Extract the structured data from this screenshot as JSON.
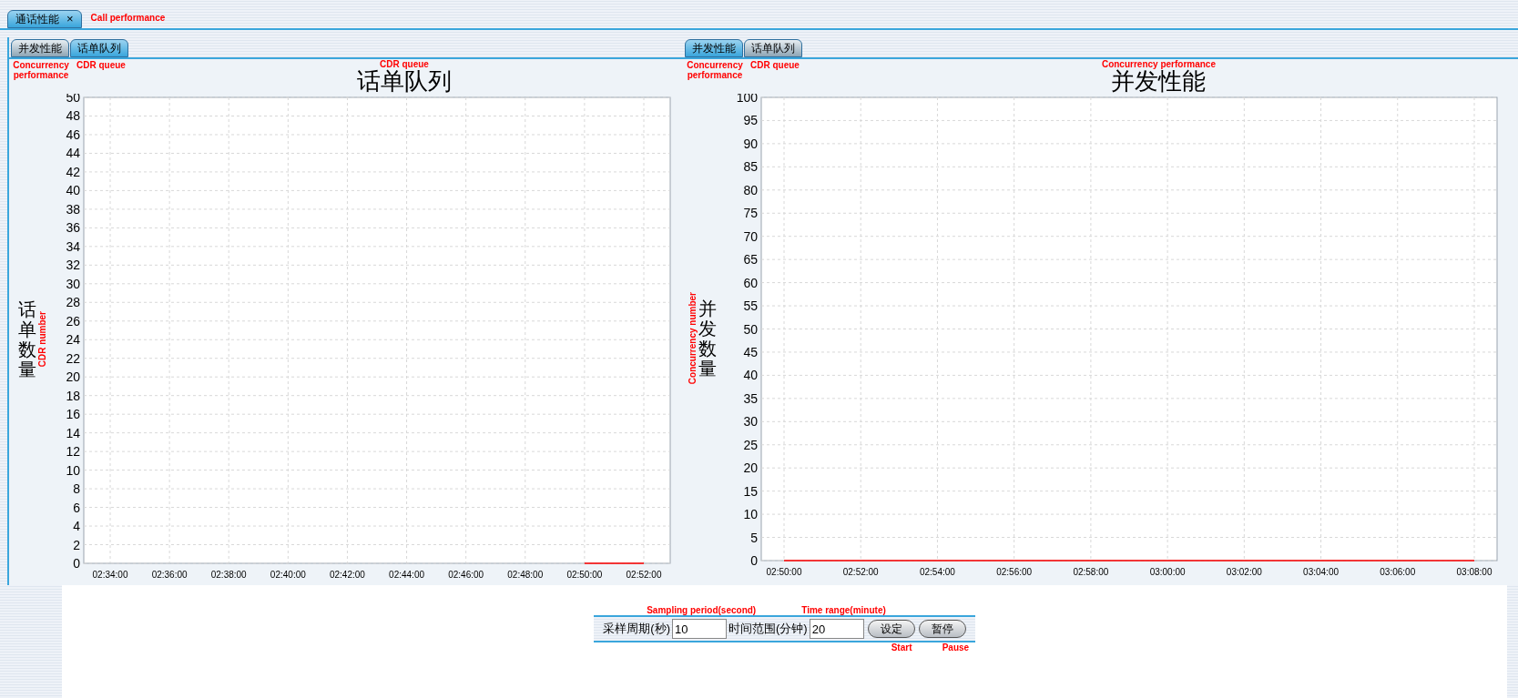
{
  "main_tab": {
    "label": "通话性能",
    "close": "×",
    "selected": true,
    "note": "Call performance"
  },
  "panels": [
    {
      "tabs": [
        {
          "label": "并发性能",
          "note": "Concurrency performance",
          "selected": false
        },
        {
          "label": "话单队列",
          "note": "CDR queue",
          "selected": true
        }
      ],
      "title": "话单队列",
      "title_note": "CDR queue",
      "ylabel": "话单数量",
      "ylabel_note": "CDR number",
      "chart_data": {
        "type": "line",
        "grid": true,
        "categories": [
          "02:34:00",
          "02:36:00",
          "02:38:00",
          "02:40:00",
          "02:42:00",
          "02:44:00",
          "02:46:00",
          "02:48:00",
          "02:50:00",
          "02:52:00"
        ],
        "ylim": [
          0,
          50
        ],
        "yticks": [
          0,
          2,
          4,
          6,
          8,
          10,
          12,
          14,
          16,
          18,
          20,
          22,
          24,
          26,
          28,
          30,
          32,
          34,
          36,
          38,
          40,
          42,
          44,
          46,
          48,
          50
        ],
        "series": [
          {
            "color": "#ff0000",
            "values": [
              null,
              null,
              null,
              null,
              null,
              null,
              null,
              null,
              0,
              0
            ]
          }
        ]
      }
    },
    {
      "tabs": [
        {
          "label": "并发性能",
          "note": "Concurrency performance",
          "selected": true
        },
        {
          "label": "话单队列",
          "note": "CDR queue",
          "selected": false
        }
      ],
      "title": "并发性能",
      "title_note": "Concurrency performance",
      "ylabel": "并发数量",
      "ylabel_note": "Concurrency number",
      "chart_data": {
        "type": "line",
        "grid": true,
        "categories": [
          "02:50:00",
          "02:52:00",
          "02:54:00",
          "02:56:00",
          "02:58:00",
          "03:00:00",
          "03:02:00",
          "03:04:00",
          "03:06:00",
          "03:08:00"
        ],
        "ylim": [
          0,
          100
        ],
        "yticks": [
          0,
          5,
          10,
          15,
          20,
          25,
          30,
          35,
          40,
          45,
          50,
          55,
          60,
          65,
          70,
          75,
          80,
          85,
          90,
          95,
          100
        ],
        "series": [
          {
            "color": "#ff0000",
            "values": [
              0,
              0,
              0,
              0,
              0,
              0,
              0,
              0,
              0,
              0
            ]
          }
        ]
      }
    }
  ],
  "controls": {
    "fields": [
      {
        "label": "采样周期(秒)",
        "value": "10",
        "note": "Sampling period(second)"
      },
      {
        "label": "时间范围(分钟)",
        "value": "20",
        "note": "Time range(minute)"
      }
    ],
    "buttons": [
      {
        "label": "设定",
        "note": "Start"
      },
      {
        "label": "暂停",
        "note": "Pause"
      }
    ]
  }
}
